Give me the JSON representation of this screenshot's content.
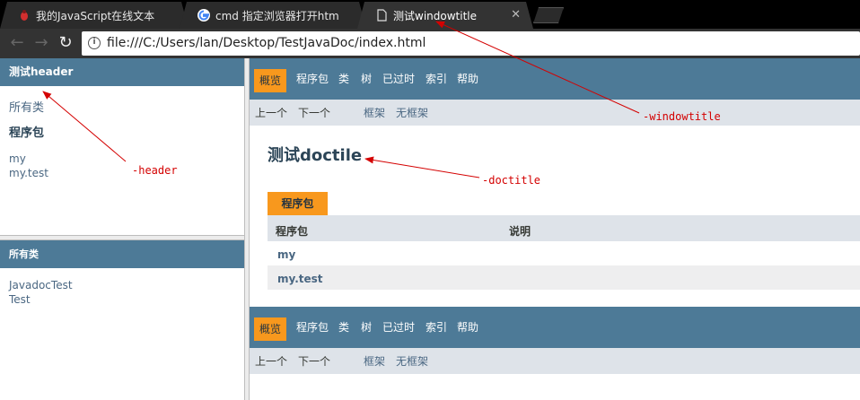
{
  "browser": {
    "tabs": [
      {
        "title": "我的JavaScript在线文本",
        "icon": "red-bug-icon",
        "active": false
      },
      {
        "title": "cmd 指定浏览器打开htm",
        "icon": "google-icon",
        "active": false
      },
      {
        "title": "测试windowtitle",
        "icon": "page-icon",
        "active": true
      }
    ],
    "url": "file:///C:/Users/lan/Desktop/TestJavaDoc/index.html"
  },
  "left": {
    "header": "测试header",
    "all_classes_link": "所有类",
    "packages_heading": "程序包",
    "packages": [
      "my",
      "my.test"
    ],
    "classes_bar": "所有类",
    "classes": [
      "JavadocTest",
      "Test"
    ]
  },
  "nav": {
    "items": [
      "概览",
      "程序包",
      "类",
      "树",
      "已过时",
      "索引",
      "帮助"
    ],
    "selected": "概览"
  },
  "subnav": {
    "prev": "上一个",
    "next": "下一个",
    "frames": "框架",
    "no_frames": "无框架"
  },
  "main": {
    "doctitle": "测试doctile",
    "caption": "程序包",
    "columns": [
      "程序包",
      "说明"
    ],
    "rows": [
      "my",
      "my.test"
    ]
  },
  "annotations": {
    "header": "-header",
    "windowtitle": "-windowtitle",
    "doctitle": "-doctitle"
  },
  "colors": {
    "bar_blue": "#4d7a97",
    "highlight_orange": "#f8981d",
    "subnav_gray": "#dee3e9",
    "annotation_red": "#d40000"
  }
}
